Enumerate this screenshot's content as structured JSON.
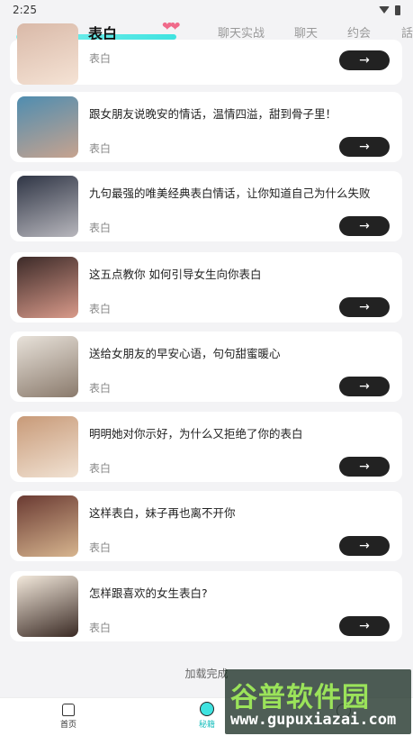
{
  "status": {
    "time": "2:25"
  },
  "tabs": [
    {
      "label": "表白",
      "active": true
    },
    {
      "label": "聊天实战",
      "active": false
    },
    {
      "label": "聊天",
      "active": false
    },
    {
      "label": "约会",
      "active": false
    },
    {
      "label": "話",
      "active": false
    }
  ],
  "items": [
    {
      "title": "",
      "tag": "表白",
      "thumb_colors": [
        "#d9b9a8",
        "#f5e3d5"
      ]
    },
    {
      "title": "跟女朋友说晚安的情话，温情四溢，甜到骨子里！",
      "tag": "表白",
      "thumb_colors": [
        "#4f8db0",
        "#c7a38f"
      ]
    },
    {
      "title": "九句最强的唯美经典表白情话，让你知道自己为什么失败",
      "tag": "表白",
      "thumb_colors": [
        "#2f3545",
        "#b8b7bd"
      ]
    },
    {
      "title": "这五点教你 如何引导女生向你表白",
      "tag": "表白",
      "thumb_colors": [
        "#3c2a28",
        "#d99a8a"
      ]
    },
    {
      "title": "送给女朋友的早安心语，句句甜蜜暖心",
      "tag": "表白",
      "thumb_colors": [
        "#e8e2da",
        "#8a7a6c"
      ]
    },
    {
      "title": "明明她对你示好，为什么又拒绝了你的表白",
      "tag": "表白",
      "thumb_colors": [
        "#c89a78",
        "#f1e2d3"
      ]
    },
    {
      "title": "这样表白，妹子再也离不开你",
      "tag": "表白",
      "thumb_colors": [
        "#6a3a32",
        "#d7b58f"
      ]
    },
    {
      "title": "怎样跟喜欢的女生表白?",
      "tag": "表白",
      "thumb_colors": [
        "#f3e9dc",
        "#3a2a24"
      ]
    }
  ],
  "go_label": "→",
  "load_done": "加载完成",
  "nav": [
    {
      "label": "首页"
    },
    {
      "label": "秘籍"
    },
    {
      "label": ""
    }
  ],
  "watermark": {
    "top": "谷普软件园",
    "bottom": "www.gupuxiazai.com"
  }
}
